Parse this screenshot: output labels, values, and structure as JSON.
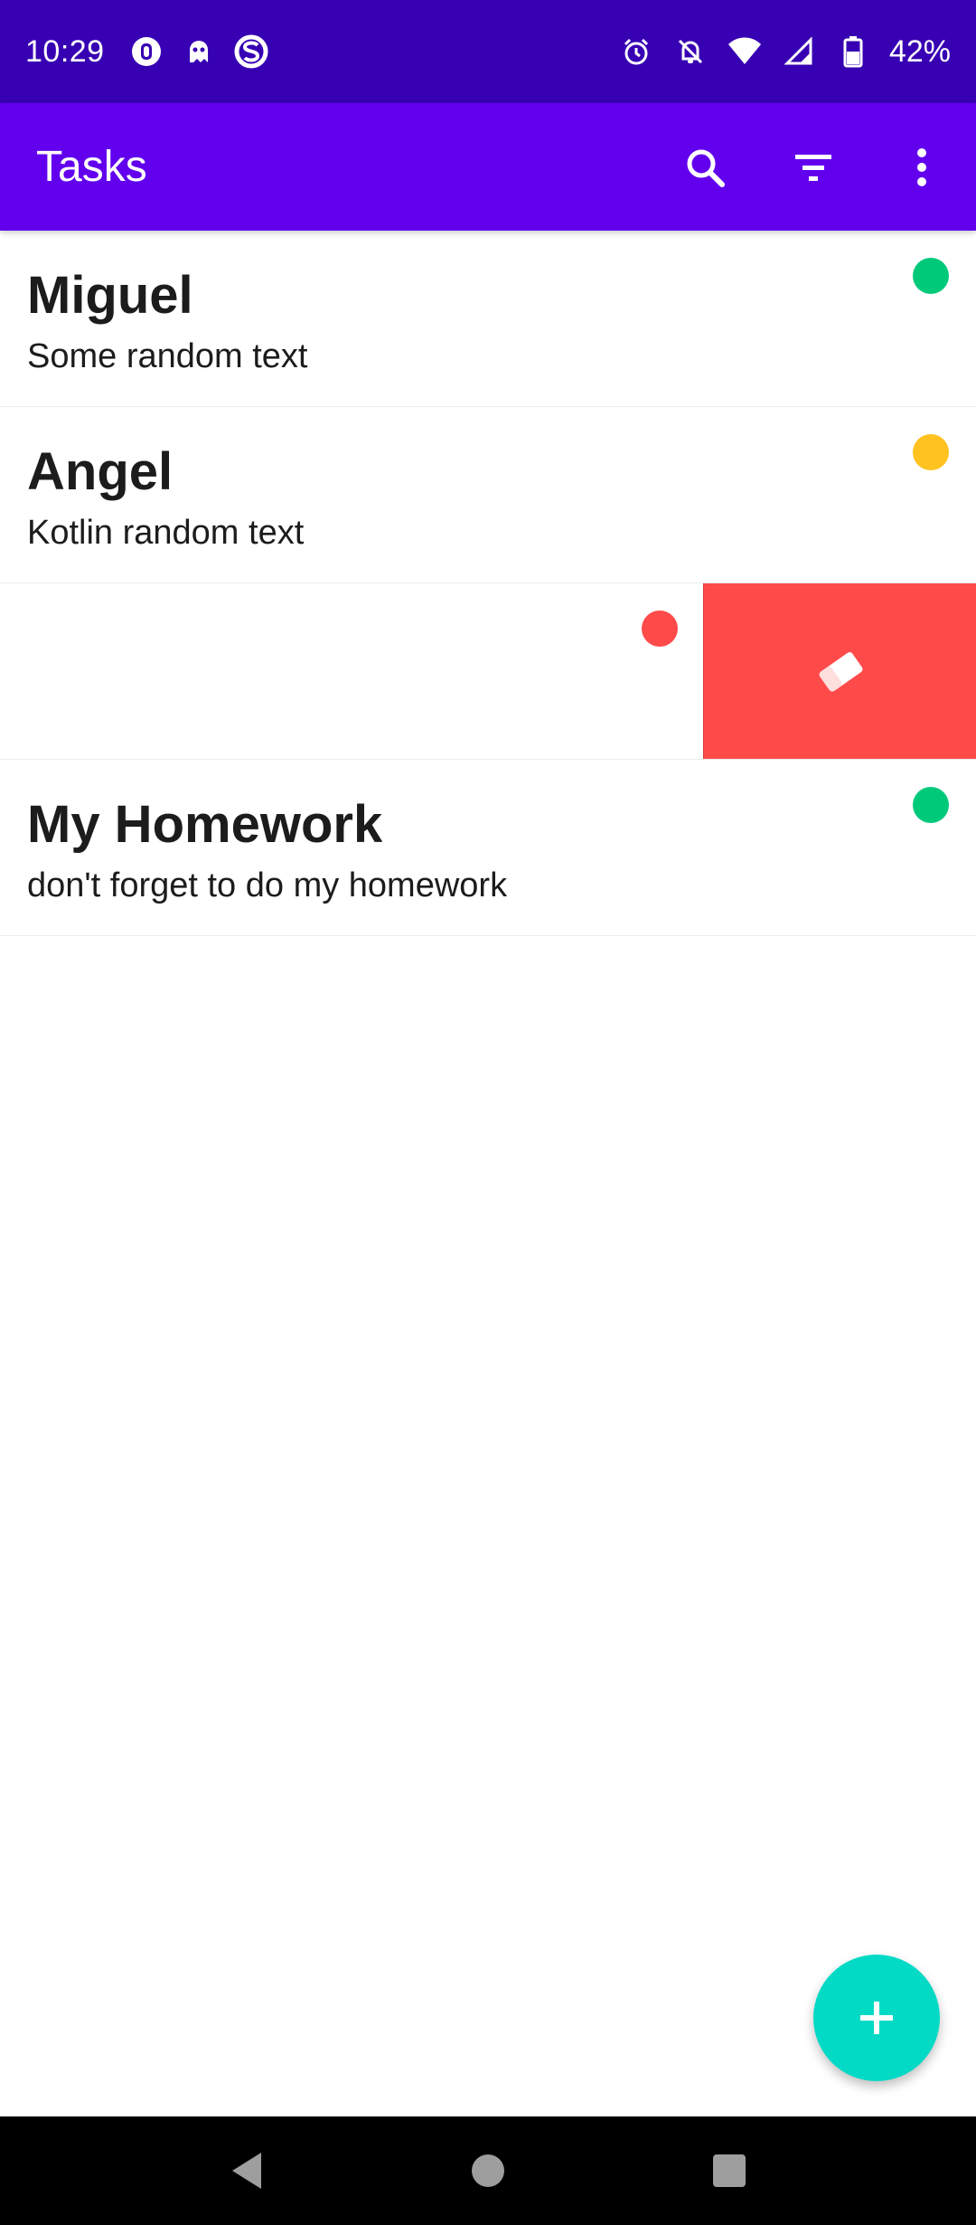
{
  "status_bar": {
    "time": "10:29",
    "battery": "42%",
    "left_icons": [
      "app-notification-icon",
      "ghost-app-icon",
      "s-app-icon"
    ],
    "right_icons": [
      "alarm-icon",
      "notifications-off-icon",
      "wifi-icon",
      "cell-signal-icon",
      "battery-icon"
    ]
  },
  "app_bar": {
    "title": "Tasks",
    "actions": [
      "search-icon",
      "filter-icon",
      "more-vert-icon"
    ]
  },
  "tasks": [
    {
      "title": "Miguel",
      "description": "Some random text",
      "priority_color": "#00c97a"
    },
    {
      "title": "Angel",
      "description": "Kotlin random text",
      "priority_color": "#ffc220"
    },
    {
      "title": "",
      "description": "",
      "priority_color": "#ff4a4a",
      "swiped": true
    },
    {
      "title": "My Homework",
      "description": "don't forget to do my homework",
      "priority_color": "#00c97a"
    }
  ],
  "swipe_action": {
    "icon": "eraser-delete-icon",
    "background": "#ff4a4a"
  },
  "fab": {
    "icon": "add-icon",
    "color": "#03dac5"
  },
  "nav_bar": {
    "buttons": [
      "back-icon",
      "home-icon",
      "recents-icon"
    ]
  },
  "colors": {
    "status_bar": "#3700b3",
    "app_bar": "#6200ee"
  }
}
